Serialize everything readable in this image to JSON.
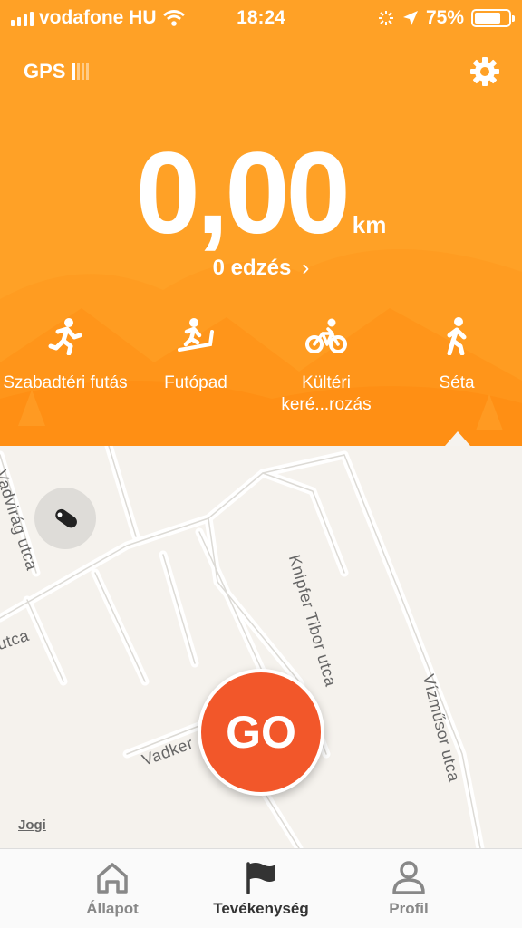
{
  "status_bar": {
    "carrier": "vodafone HU",
    "time": "18:24",
    "battery": "75%"
  },
  "header": {
    "gps_label": "GPS",
    "distance": "0,00",
    "unit": "km",
    "workouts": "0 edzés"
  },
  "modes": [
    {
      "label": "Szabadtéri futás",
      "icon": "outdoor-run-icon"
    },
    {
      "label": "Futópad",
      "icon": "treadmill-icon"
    },
    {
      "label": "Kültéri keré...rozás",
      "icon": "bicycle-icon"
    },
    {
      "label": "Séta",
      "icon": "walk-icon"
    }
  ],
  "selected_mode": "Séta",
  "map": {
    "streets": [
      "Vadvirág utca",
      "utca",
      "Knipfer Tibor utca",
      "Vízműsor utca",
      "Vadker"
    ],
    "legal": "Jogi"
  },
  "go_button": "GO",
  "tabbar": {
    "tabs": [
      "Állapot",
      "Tevékenység",
      "Profil"
    ],
    "active": "Tevékenység"
  },
  "colors": {
    "accent": "#ffa126",
    "go": "#f2572a"
  }
}
